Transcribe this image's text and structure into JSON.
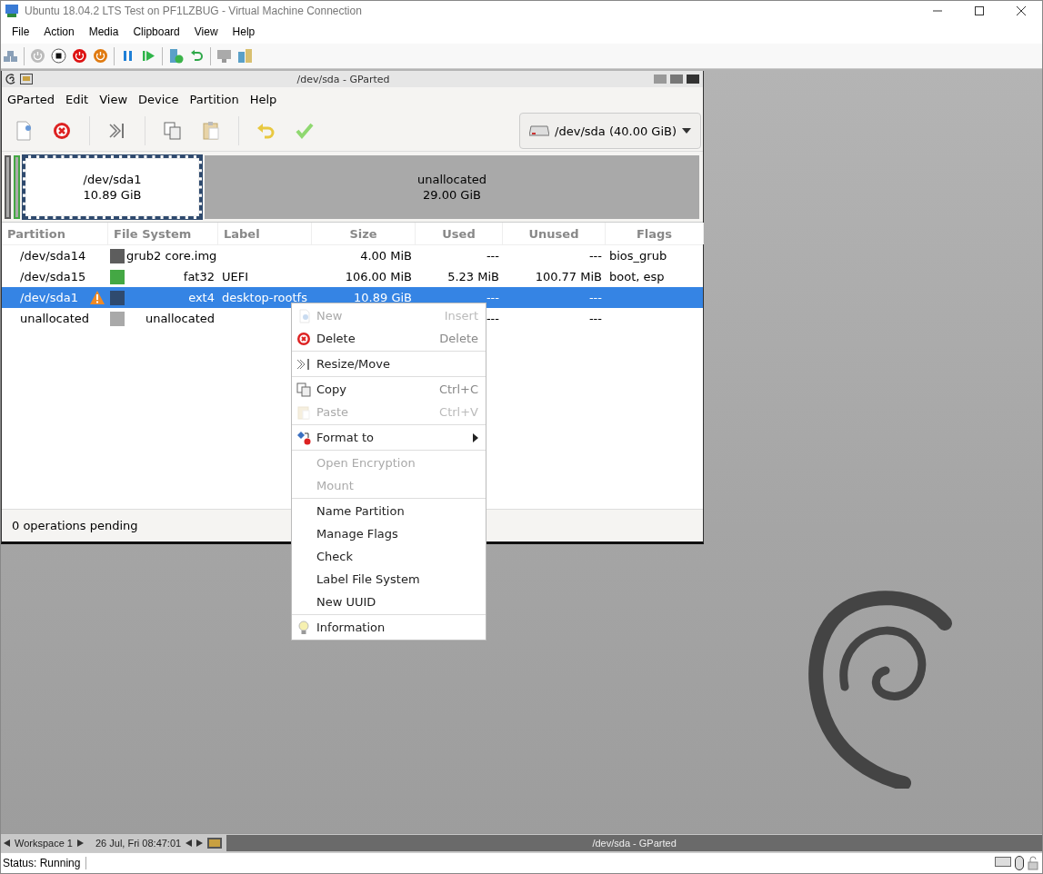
{
  "window": {
    "title": "Ubuntu 18.04.2 LTS Test on PF1LZBUG - Virtual Machine Connection"
  },
  "menu": [
    "File",
    "Action",
    "Media",
    "Clipboard",
    "View",
    "Help"
  ],
  "gparted": {
    "title": "/dev/sda - GParted",
    "menu": [
      "GParted",
      "Edit",
      "View",
      "Device",
      "Partition",
      "Help"
    ],
    "device": "/dev/sda (40.00 GiB)",
    "disk_map": [
      {
        "kind": "sliver",
        "color": "#5d5d5d"
      },
      {
        "kind": "sliver",
        "color": "#44a844"
      },
      {
        "kind": "partition",
        "name": "/dev/sda1",
        "size": "10.89 GiB",
        "selected": true
      },
      {
        "kind": "unallocated",
        "name": "unallocated",
        "size": "29.00 GiB",
        "selected": false
      }
    ],
    "columns": [
      "Partition",
      "File System",
      "Label",
      "Size",
      "Used",
      "Unused",
      "Flags"
    ],
    "rows": [
      {
        "partition": "/dev/sda14",
        "warning": false,
        "color": "#5d5d5d",
        "file_system": "grub2 core.img",
        "label": "",
        "size": "4.00 MiB",
        "used": "---",
        "unused": "---",
        "flags": "bios_grub",
        "selected": false
      },
      {
        "partition": "/dev/sda15",
        "warning": false,
        "color": "#44a844",
        "file_system": "fat32",
        "label": "UEFI",
        "size": "106.00 MiB",
        "used": "5.23 MiB",
        "unused": "100.77 MiB",
        "flags": "boot, esp",
        "selected": false
      },
      {
        "partition": "/dev/sda1",
        "warning": true,
        "color": "#2f4a6e",
        "file_system": "ext4",
        "label": "desktop-rootfs",
        "size": "10.89 GiB",
        "used": "---",
        "unused": "---",
        "flags": "",
        "selected": true
      },
      {
        "partition": "unallocated",
        "warning": false,
        "color": "#a9a9a9",
        "file_system": "unallocated",
        "label": "",
        "size": "",
        "used": "---",
        "unused": "---",
        "flags": "",
        "selected": false
      }
    ],
    "status": "0 operations pending"
  },
  "context_menu": [
    [
      {
        "label": "New",
        "shortcut": "Insert",
        "disabled": true
      },
      {
        "label": "Delete",
        "shortcut": "Delete",
        "disabled": false
      }
    ],
    [
      {
        "label": "Resize/Move",
        "disabled": false
      }
    ],
    [
      {
        "label": "Copy",
        "shortcut": "Ctrl+C",
        "disabled": false
      },
      {
        "label": "Paste",
        "shortcut": "Ctrl+V",
        "disabled": true
      }
    ],
    [
      {
        "label": "Format to",
        "disabled": false,
        "submenu": true
      }
    ],
    [
      {
        "label": "Open Encryption",
        "disabled": true
      },
      {
        "label": "Mount",
        "disabled": true
      }
    ],
    [
      {
        "label": "Name Partition",
        "disabled": false
      },
      {
        "label": "Manage Flags",
        "disabled": false
      },
      {
        "label": "Check",
        "disabled": false
      },
      {
        "label": "Label File System",
        "disabled": false
      },
      {
        "label": "New UUID",
        "disabled": false
      }
    ],
    [
      {
        "label": "Information",
        "disabled": false
      }
    ]
  ],
  "taskbar": {
    "workspace": "Workspace 1",
    "clock": "26 Jul, Fri 08:47:01",
    "task": "/dev/sda - GParted"
  },
  "status_bar": "Status: Running"
}
